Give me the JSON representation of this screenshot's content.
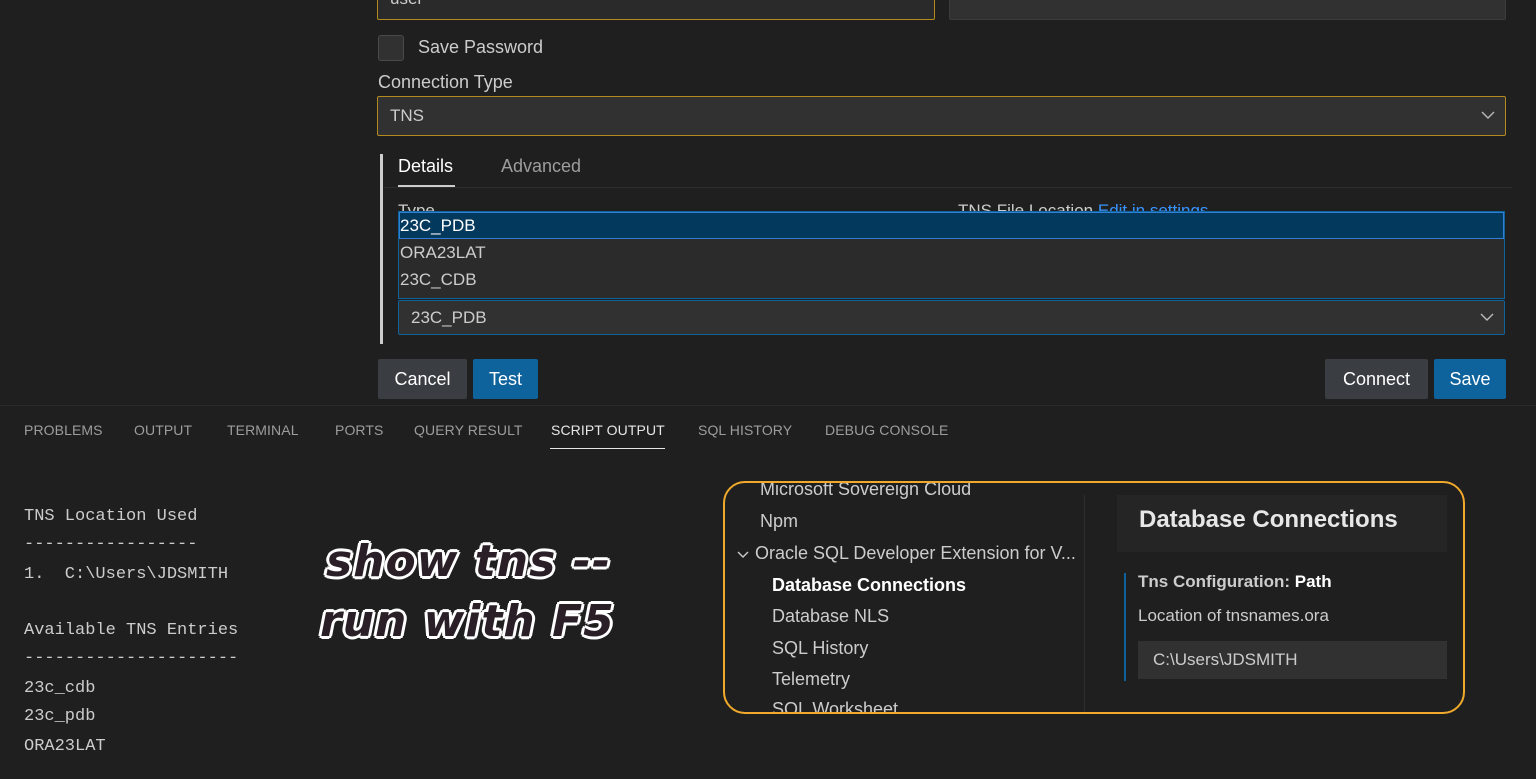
{
  "form": {
    "username_value": "user",
    "password_value": "",
    "save_password_label": "Save Password",
    "connection_type_label": "Connection Type",
    "connection_type_value": "TNS",
    "tabs": [
      {
        "label": "Details"
      },
      {
        "label": "Advanced"
      }
    ],
    "type_label": "Type",
    "tns_file_location_label": "TNS File Location",
    "edit_in_settings_link": "Edit in settings",
    "tns_options": [
      "23C_PDB",
      "ORA23LAT",
      "23C_CDB"
    ],
    "tns_selected": "23C_PDB",
    "buttons": {
      "cancel": "Cancel",
      "test": "Test",
      "connect": "Connect",
      "save": "Save"
    }
  },
  "panel": {
    "tabs": [
      "PROBLEMS",
      "OUTPUT",
      "TERMINAL",
      "PORTS",
      "QUERY RESULT",
      "SCRIPT OUTPUT",
      "SQL HISTORY",
      "DEBUG CONSOLE"
    ],
    "active_tab": "SCRIPT OUTPUT",
    "output_lines": [
      "TNS Location Used",
      "-----------------",
      "1.  C:\\Users\\JDSMITH",
      "",
      "Available TNS Entries",
      "---------------------",
      "23c_cdb",
      "23c_pdb",
      "ORA23LAT"
    ]
  },
  "annotation": {
    "line1": "show tns --",
    "line2": "run with F5"
  },
  "settings": {
    "tree": [
      {
        "label": "Microsoft Sovereign Cloud"
      },
      {
        "label": "Npm"
      },
      {
        "label": "Oracle SQL Developer Extension for V..."
      },
      {
        "label": "Database Connections"
      },
      {
        "label": "Database NLS"
      },
      {
        "label": "SQL History"
      },
      {
        "label": "Telemetry"
      },
      {
        "label": "SQL Worksheet"
      }
    ],
    "section_header": "Database Connections",
    "setting_title_prefix": "Tns Configuration: ",
    "setting_title_name": "Path",
    "setting_description": "Location of tnsnames.ora",
    "setting_value": "C:\\Users\\JDSMITH"
  },
  "colors": {
    "focus_border": "#b28a1e",
    "primary_button": "#0e639c",
    "callout_border": "#f0a92b",
    "link": "#3794ff"
  },
  "icons": [
    "chevron-down-icon"
  ]
}
